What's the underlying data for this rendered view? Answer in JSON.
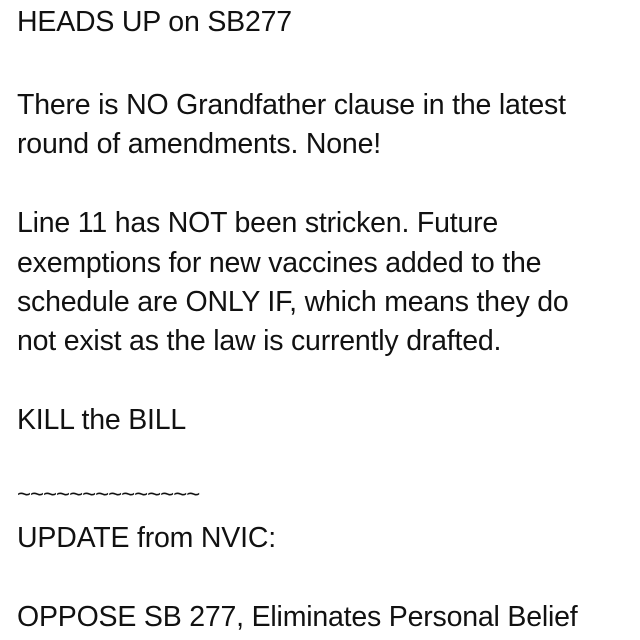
{
  "note": {
    "heading": "HEADS UP on SB277",
    "para1": [
      "There is NO Grandfather clause in the latest",
      "round of amendments. None!"
    ],
    "para2": [
      "Line 11 has NOT been stricken. Future",
      "exemptions for new vaccines added to the",
      "schedule are ONLY IF, which means they do",
      "not exist as the law is currently drafted."
    ],
    "call_to_action": "KILL the BILL",
    "separator": "~~~~~~~~~~~~~~",
    "update_heading": "UPDATE from NVIC:",
    "update_text": "OPPOSE SB 277, Eliminates Personal Belief"
  }
}
